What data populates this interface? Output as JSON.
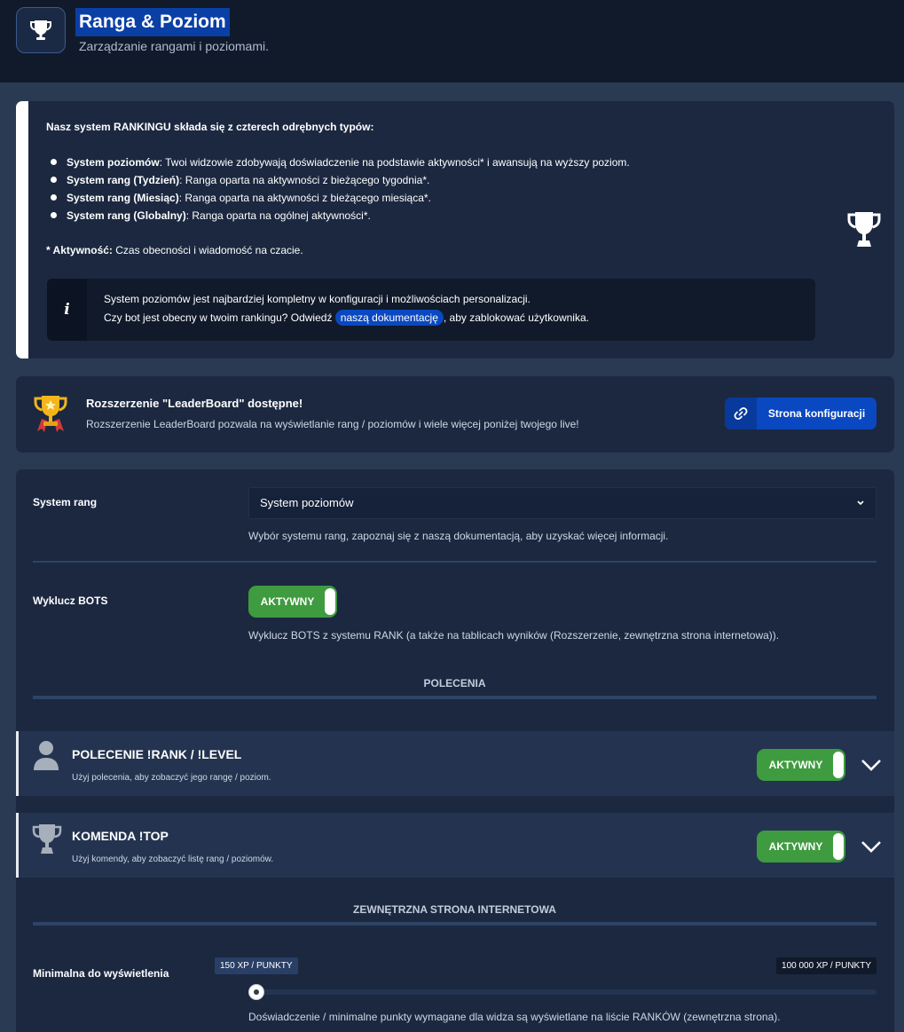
{
  "header": {
    "title": "Ranga & Poziom",
    "subtitle": "Zarządzanie rangami i poziomami.",
    "icon": "trophy-icon"
  },
  "info": {
    "heading": "Nasz system RANKINGU składa się z czterech odrębnych typów:",
    "bullets": [
      {
        "term": "System poziomów",
        "text": ": Twoi widzowie zdobywają doświadczenie na podstawie aktywności* i awansują na wyższy poziom."
      },
      {
        "term": "System rang (Tydzień)",
        "text": ": Ranga oparta na aktywności z bieżącego tygodnia*."
      },
      {
        "term": "System rang (Miesiąc)",
        "text": ": Ranga oparta na aktywności z bieżącego miesiąca*."
      },
      {
        "term": "System rang (Globalny)",
        "text": ": Ranga oparta na ogólnej aktywności*."
      }
    ],
    "activity_term": "* Aktywność:",
    "activity_text": " Czas obecności i wiadomość na czacie.",
    "note_line1": "System poziomów jest najbardziej kompletny w konfiguracji i możliwościach personalizacji.",
    "note_line2_before": "Czy bot jest obecny w twoim rankingu? Odwiedź ",
    "note_link": "naszą dokumentację",
    "note_line2_after": ", aby zablokować użytkownika.",
    "note_icon_glyph": "i"
  },
  "leaderboard": {
    "title": "Rozszerzenie \"LeaderBoard\" dostępne!",
    "subtitle": "Rozszerzenie LeaderBoard pozwala na wyświetlanie rang / poziomów i wiele więcej poniżej twojego live!",
    "button_label": "Strona konfiguracji",
    "button_icon": "link-icon"
  },
  "settings": {
    "rank_system_label": "System rang",
    "rank_system_value": "System poziomów",
    "rank_system_help": "Wybór systemu rang, zapoznaj się z naszą dokumentacją, aby uzyskać więcej informacji.",
    "exclude_bots_label": "Wyklucz BOTS",
    "exclude_bots_toggle": "AKTYWNY",
    "exclude_bots_help": "Wyklucz BOTS z systemu RANK (a także na tablicach wyników (Rozszerzenie, zewnętrzna strona internetowa)).",
    "commands_heading": "POLECENIA",
    "commands": [
      {
        "title": "POLECENIE !RANK / !LEVEL",
        "subtitle": "Użyj polecenia, aby zobaczyć jego rangę / poziom.",
        "toggle": "AKTYWNY",
        "icon": "user-icon"
      },
      {
        "title": "KOMENDA !TOP",
        "subtitle": "Użyj komendy, aby zobaczyć listę rang / poziomów.",
        "toggle": "AKTYWNY",
        "icon": "trophy-icon"
      }
    ],
    "external_heading": "ZEWNĘTRZNA STRONA INTERNETOWA",
    "min_display_label": "Minimalna do wyświetlenia",
    "slider_value": "150 XP / PUNKTY",
    "slider_max": "100 000 XP / PUNKTY",
    "slider_fraction": 0.0,
    "min_display_help": "Doświadczenie / minimalne punkty wymagane dla widza są wyświetlane na liście RANKÓW (zewnętrzna strona)."
  },
  "colors": {
    "accent": "#0a48c2",
    "active_toggle": "#3f9b3f",
    "card": "#1b2840",
    "background": "#2a3a52"
  }
}
